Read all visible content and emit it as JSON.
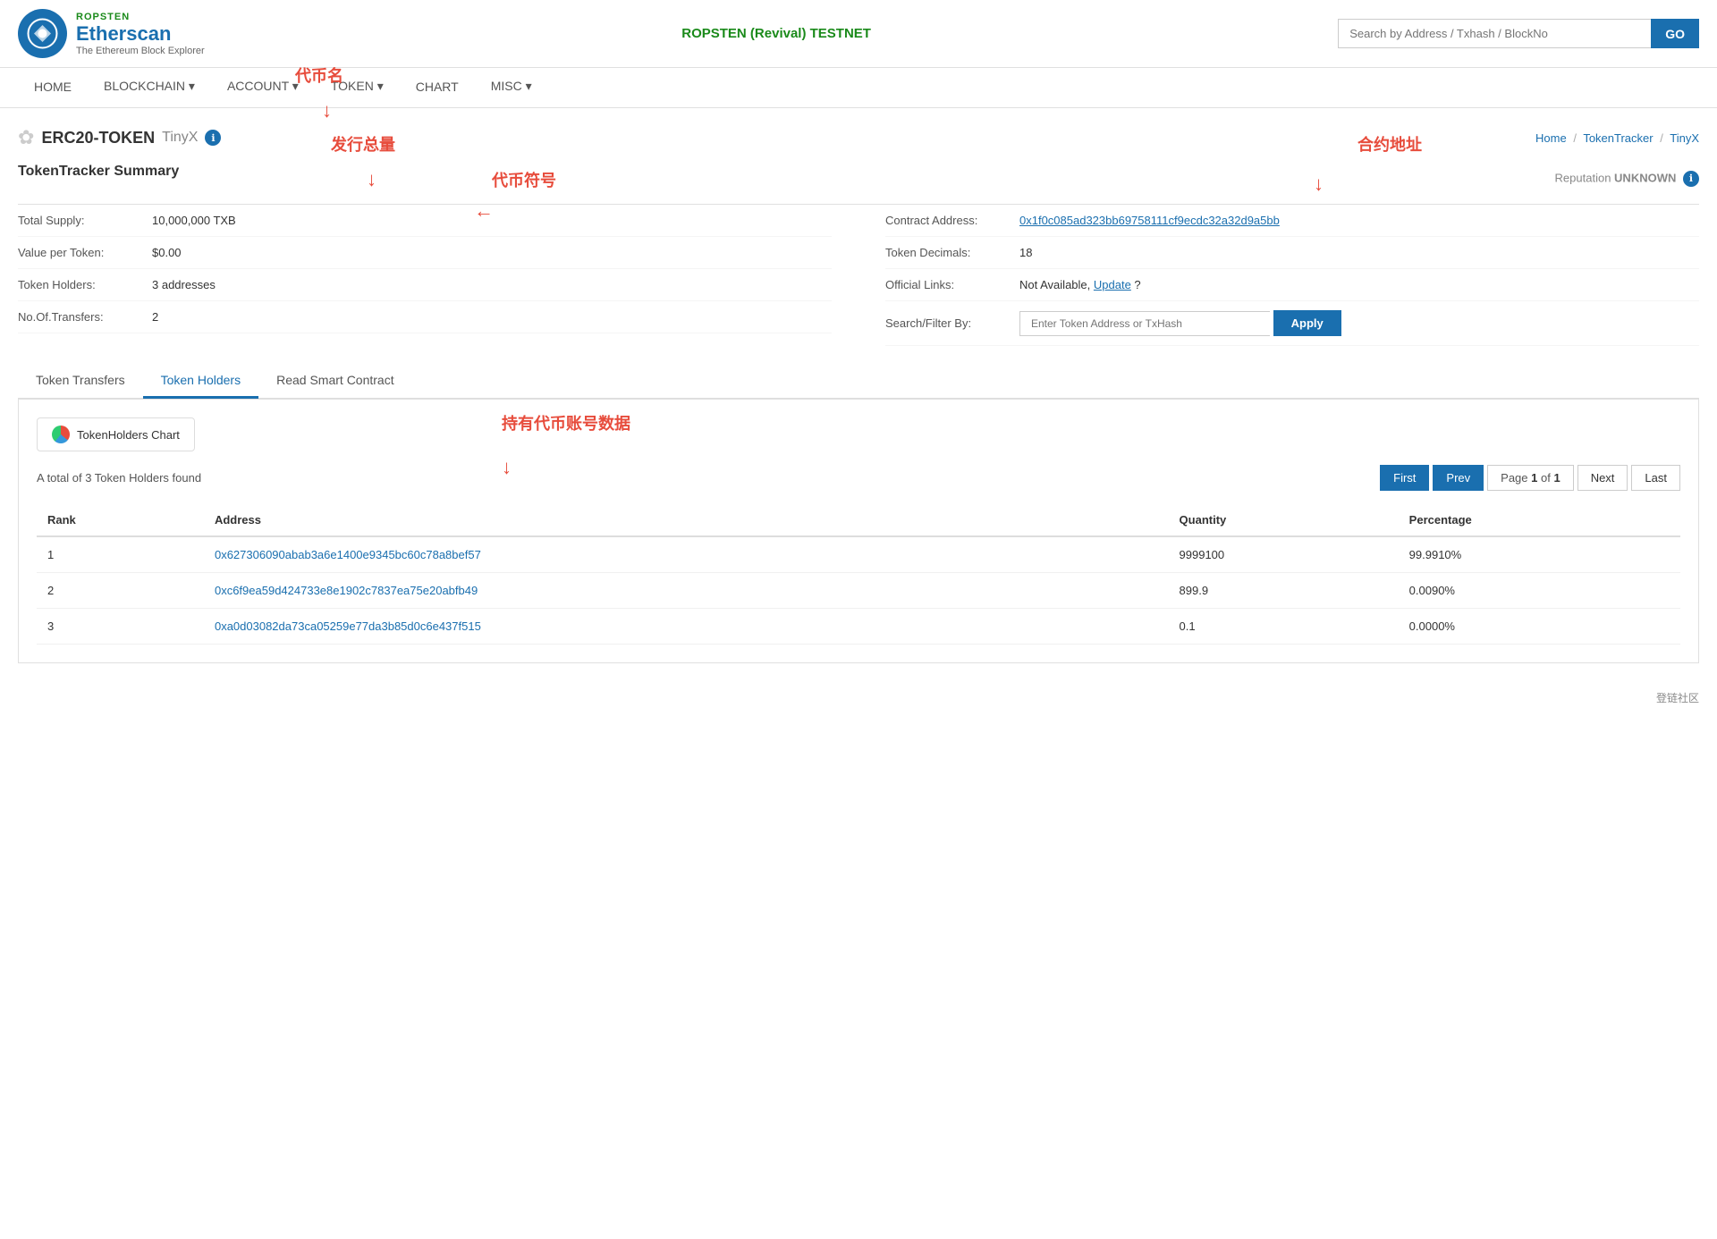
{
  "header": {
    "logo_ropsten": "ROPSTEN",
    "logo_name": "Etherscan",
    "logo_tagline": "The Ethereum Block Explorer",
    "network": "ROPSTEN (Revival) TESTNET",
    "search_placeholder": "Search by Address / Txhash / BlockNo",
    "search_btn": "GO"
  },
  "nav": {
    "items": [
      {
        "label": "HOME",
        "active": false
      },
      {
        "label": "BLOCKCHAIN",
        "active": false,
        "has_dropdown": true
      },
      {
        "label": "ACCOUNT",
        "active": false,
        "has_dropdown": true
      },
      {
        "label": "TOKEN",
        "active": false,
        "has_dropdown": true
      },
      {
        "label": "CHART",
        "active": false
      },
      {
        "label": "MISC",
        "active": false,
        "has_dropdown": true
      }
    ]
  },
  "breadcrumb": {
    "home": "Home",
    "sep1": "/",
    "token_tracker": "TokenTracker",
    "sep2": "/",
    "current": "TinyX"
  },
  "page_title": {
    "token_name": "ERC20-TOKEN",
    "token_symbol": "TinyX",
    "info_icon": "ℹ"
  },
  "reputation": {
    "label": "Reputation",
    "value": "UNKNOWN",
    "info_icon": "ℹ"
  },
  "summary": {
    "title": "TokenTracker Summary",
    "left_fields": [
      {
        "label": "Total Supply:",
        "value": "10,000,000 TXB"
      },
      {
        "label": "Value per Token:",
        "value": "$0.00"
      },
      {
        "label": "Token Holders:",
        "value": "3 addresses"
      },
      {
        "label": "No.Of.Transfers:",
        "value": "2"
      }
    ],
    "right_fields": [
      {
        "label": "Contract Address:",
        "value": "0x1f0c085ad323bb69758111cf9ecdc32a32d9a5bb",
        "is_link": true
      },
      {
        "label": "Token Decimals:",
        "value": "18"
      },
      {
        "label": "Official Links:",
        "value_prefix": "Not Available, ",
        "link_text": "Update",
        "value_suffix": " ?"
      },
      {
        "label": "Search/Filter By:",
        "input_placeholder": "Enter Token Address or TxHash",
        "btn_label": "Apply"
      }
    ]
  },
  "tabs": [
    {
      "label": "Token Transfers",
      "active": false
    },
    {
      "label": "Token Holders",
      "active": true
    },
    {
      "label": "Read Smart Contract",
      "active": false
    }
  ],
  "token_holders": {
    "chart_btn": "TokenHolders Chart",
    "result_count": "A total of 3 Token Holders found",
    "pagination": {
      "first": "First",
      "prev": "Prev",
      "page_of": "Page",
      "page_num": "1",
      "of": "of",
      "total_pages": "1",
      "next": "Next",
      "last": "Last"
    },
    "columns": [
      "Rank",
      "Address",
      "Quantity",
      "Percentage"
    ],
    "rows": [
      {
        "rank": "1",
        "address": "0x627306090abab3a6e1400e9345bc60c78a8bef57",
        "quantity": "9999100",
        "percentage": "99.9910%"
      },
      {
        "rank": "2",
        "address": "0xc6f9ea59d424733e8e1902c7837ea75e20abfb49",
        "quantity": "899.9",
        "percentage": "0.0090%"
      },
      {
        "rank": "3",
        "address": "0xa0d03082da73ca05259e77da3b85d0c6e437f515",
        "quantity": "0.1",
        "percentage": "0.0000%"
      }
    ]
  },
  "annotations": {
    "coin_name": "代币名",
    "total_supply": "发行总量",
    "coin_symbol": "代币符号",
    "contract_address": "合约地址",
    "holders_data": "持有代币账号数据"
  },
  "footer": {
    "watermark": "登链社区"
  }
}
